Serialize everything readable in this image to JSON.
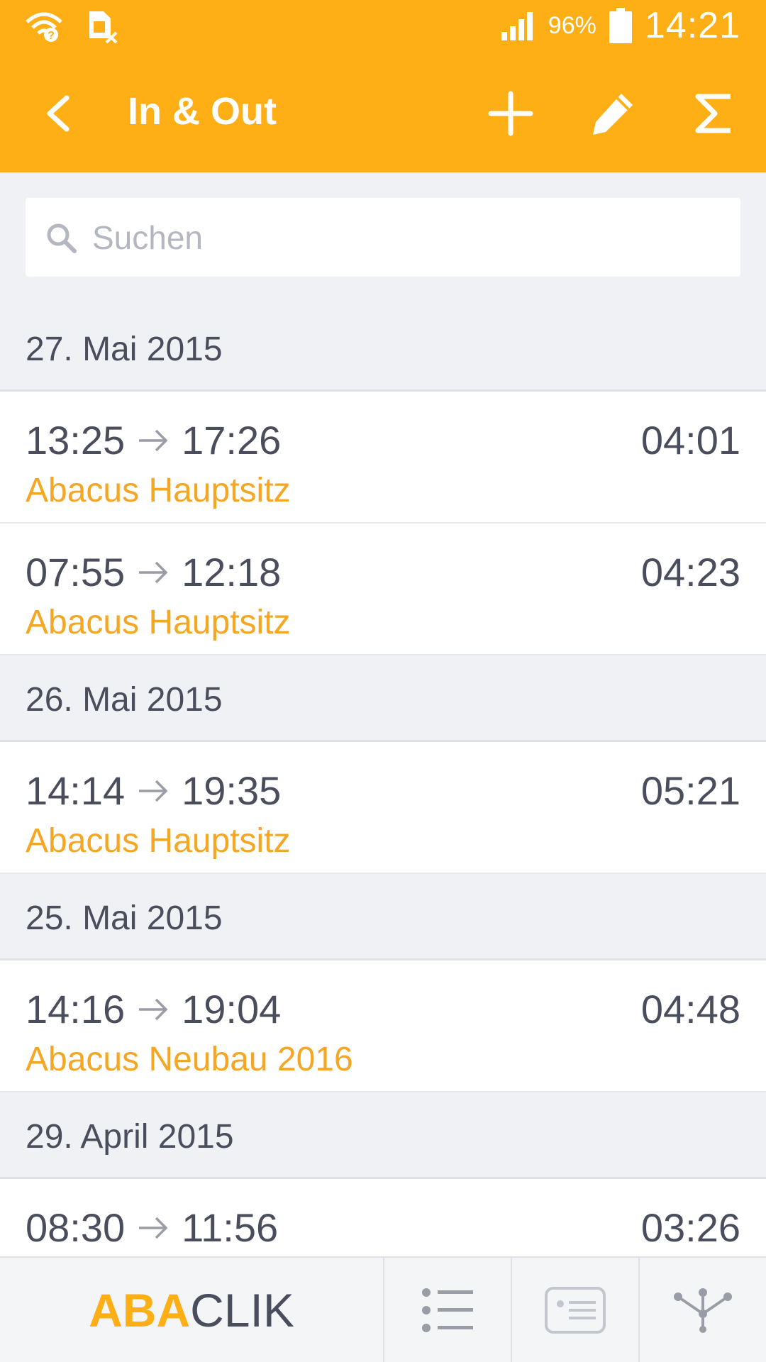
{
  "status_bar": {
    "battery_percent": "96%",
    "time": "14:21",
    "icons": [
      "wifi-question-icon",
      "sim-error-icon",
      "signal-icon",
      "battery-icon"
    ]
  },
  "app_bar": {
    "title": "In & Out",
    "actions": [
      "back-icon",
      "add-icon",
      "edit-icon",
      "sum-icon"
    ]
  },
  "search": {
    "placeholder": "Suchen"
  },
  "groups": [
    {
      "date": "27. Mai 2015",
      "entries": [
        {
          "start": "13:25",
          "end": "17:26",
          "duration": "04:01",
          "location": "Abacus Hauptsitz"
        },
        {
          "start": "07:55",
          "end": "12:18",
          "duration": "04:23",
          "location": "Abacus Hauptsitz"
        }
      ]
    },
    {
      "date": "26. Mai 2015",
      "entries": [
        {
          "start": "14:14",
          "end": "19:35",
          "duration": "05:21",
          "location": "Abacus Hauptsitz"
        }
      ]
    },
    {
      "date": "25. Mai 2015",
      "entries": [
        {
          "start": "14:16",
          "end": "19:04",
          "duration": "04:48",
          "location": "Abacus Neubau 2016"
        }
      ]
    },
    {
      "date": "29. April 2015",
      "entries": [
        {
          "start": "08:30",
          "end": "11:56",
          "duration": "03:26",
          "location": ""
        }
      ]
    }
  ],
  "bottom_nav": {
    "brand_part1": "ABA",
    "brand_part2": "CLIK",
    "tabs": [
      "list-icon",
      "id-card-icon",
      "network-icon"
    ]
  },
  "colors": {
    "accent": "#fdaf15",
    "location_text": "#f5a623",
    "text": "#4a4d5c",
    "background": "#f0f1f4"
  }
}
